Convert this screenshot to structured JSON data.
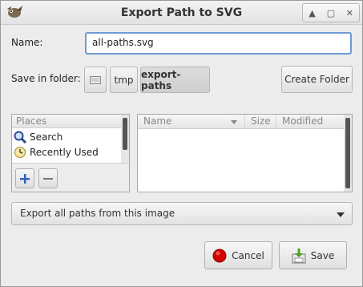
{
  "window": {
    "title": "Export Path to SVG",
    "controls": [
      "restore",
      "maximize",
      "close"
    ]
  },
  "name": {
    "label": "Name:",
    "value": "all-paths.svg"
  },
  "folder": {
    "label": "Save in folder:",
    "path": [
      "tmp",
      "export-paths"
    ],
    "create_label": "Create Folder"
  },
  "places": {
    "header": "Places",
    "items": [
      {
        "label": "Search",
        "icon": "search-icon"
      },
      {
        "label": "Recently Used",
        "icon": "recent-icon"
      }
    ]
  },
  "files": {
    "columns": [
      "Name",
      "Size",
      "Modified"
    ]
  },
  "export_mode": {
    "selected": "Export all paths from this image"
  },
  "actions": {
    "cancel_label": "Cancel",
    "save_label": "Save"
  },
  "colors": {
    "focus_border": "#6f9ad5",
    "cancel_icon": "#d40000",
    "save_icon": "#4aa12a"
  }
}
